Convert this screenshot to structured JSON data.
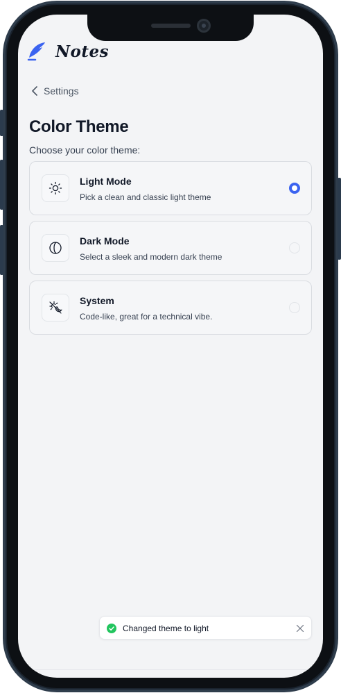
{
  "app": {
    "name": "Notes",
    "accent_color": "#3b63f0",
    "brand_icon": "quill-icon"
  },
  "nav": {
    "back_label": "Settings",
    "back_icon": "chevron-left-icon"
  },
  "page": {
    "title": "Color Theme",
    "subtitle": "Choose your color theme:"
  },
  "theme_options": [
    {
      "title": "Light Mode",
      "description": "Pick a clean and classic light theme",
      "icon": "sun-icon",
      "selected": true
    },
    {
      "title": "Dark Mode",
      "description": "Select a sleek and modern dark theme",
      "icon": "moon-icon",
      "selected": false
    },
    {
      "title": "System",
      "description": "Code-like, great for a technical vibe.",
      "icon": "sun-moon-icon",
      "selected": false
    }
  ],
  "toast": {
    "message": "Changed theme to light",
    "status_icon": "check-circle-icon",
    "status_color": "#22c55e",
    "close_icon": "close-icon"
  }
}
